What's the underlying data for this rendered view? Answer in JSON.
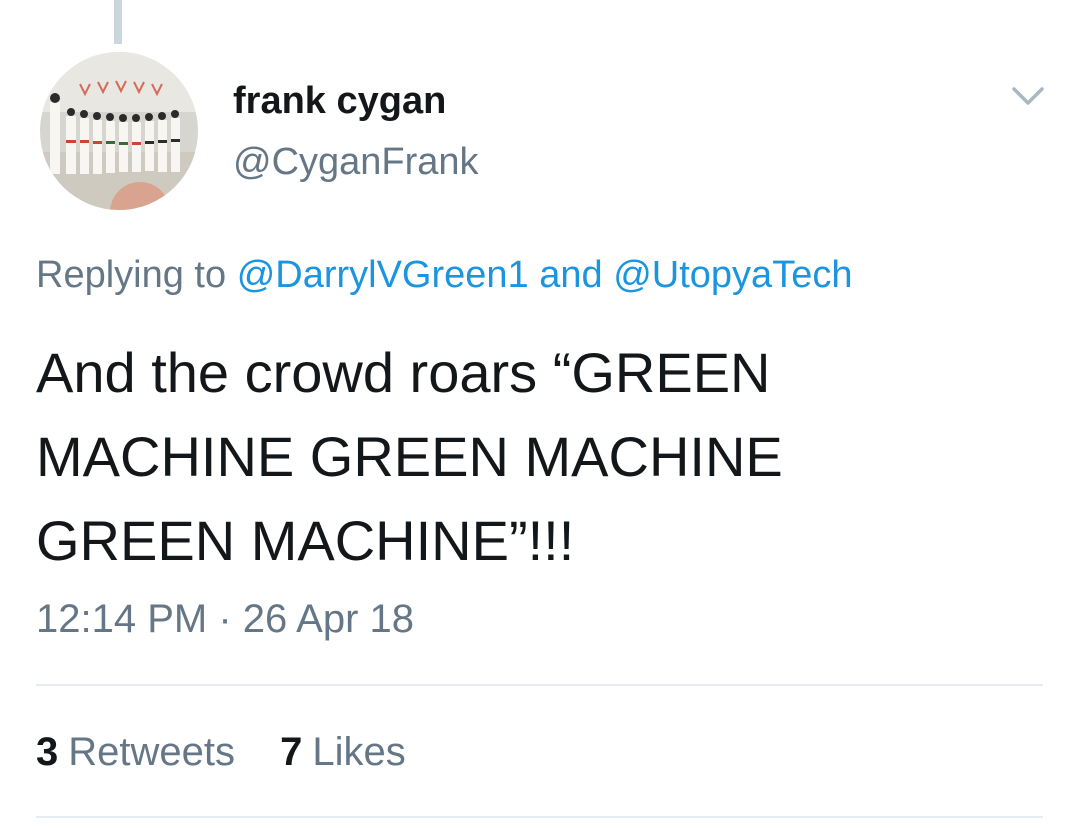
{
  "tweet": {
    "display_name": "frank cygan",
    "handle": "@CyganFrank",
    "reply_prefix": "Replying to",
    "reply_mentions": [
      "@DarrylVGreen1",
      "@UtopyaTech"
    ],
    "reply_joiner": "and",
    "text_lines": [
      "And the crowd roars “GREEN",
      "MACHINE GREEN MACHINE",
      "GREEN MACHINE”!!!"
    ],
    "timestamp": "12:14 PM · 26 Apr 18",
    "stats": {
      "retweets_count": "3",
      "retweets_label": "Retweets",
      "likes_count": "7",
      "likes_label": "Likes"
    }
  },
  "icons": {
    "menu": "chevron-down-icon",
    "avatar": "avatar-photo"
  },
  "colors": {
    "text_primary": "#14171a",
    "text_secondary": "#657786",
    "link": "#1b95e0",
    "divider": "#e6ecf0",
    "thread_line": "#ccd6dd"
  }
}
